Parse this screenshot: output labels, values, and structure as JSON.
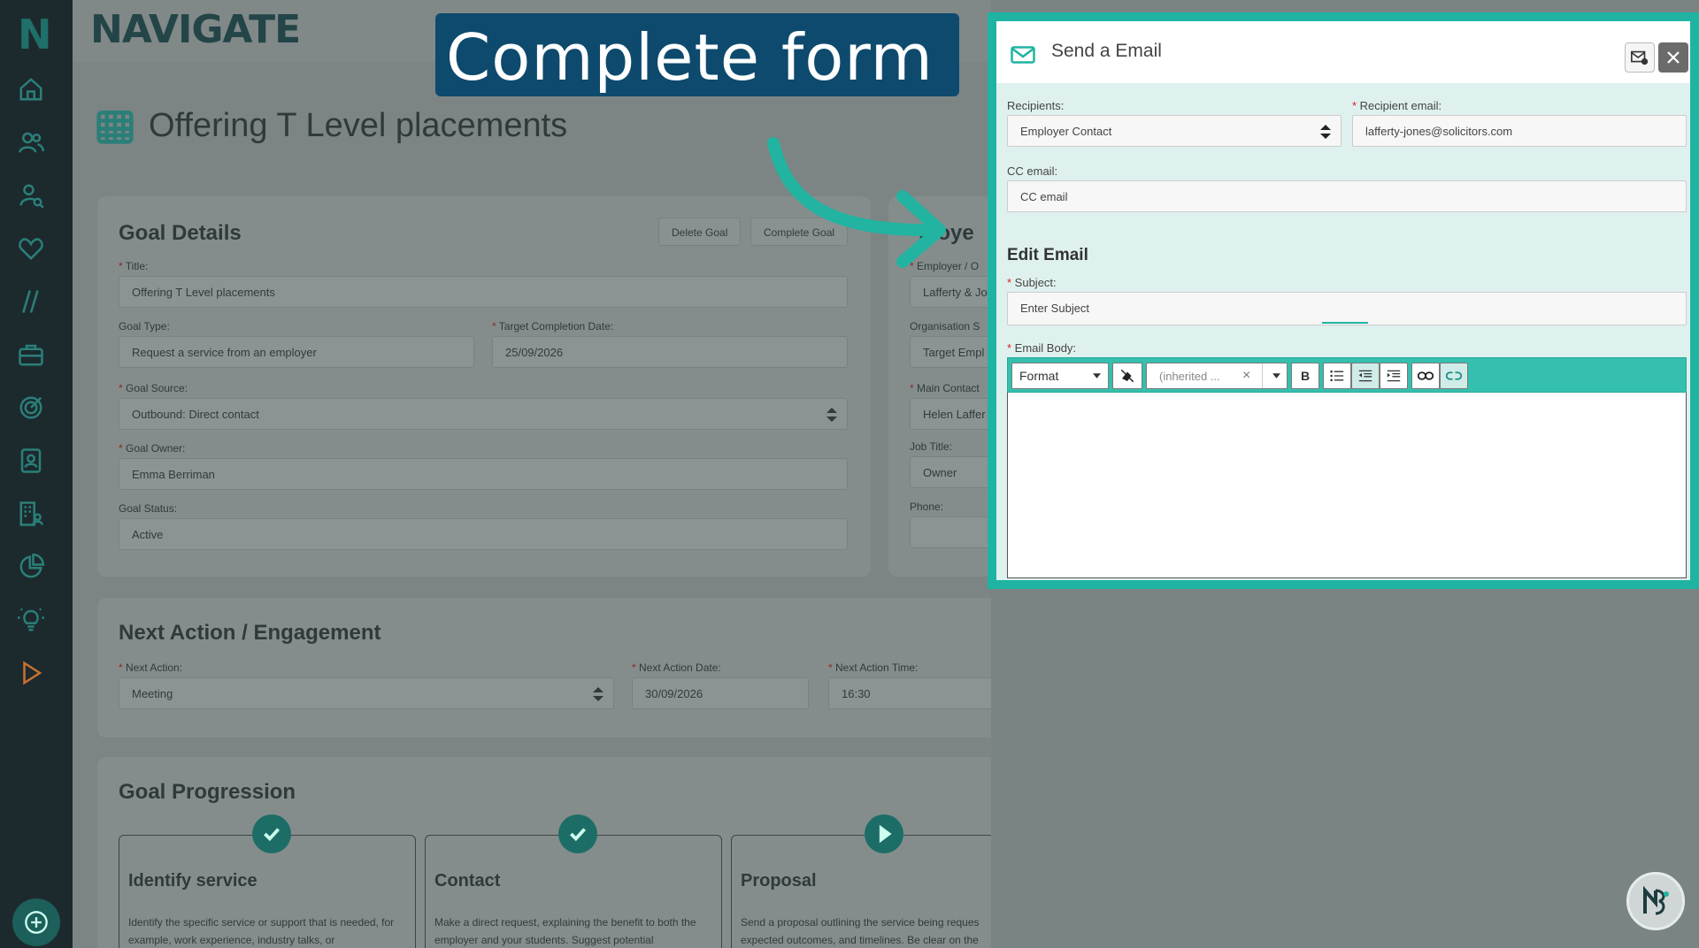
{
  "brand": {
    "logo_letter": "N",
    "wordmark": "NAVIGATE"
  },
  "page": {
    "title": "Offering T Level placements"
  },
  "goal_details": {
    "heading": "Goal Details",
    "delete_label": "Delete Goal",
    "complete_label": "Complete Goal",
    "title_label": "Title:",
    "title_value": "Offering T Level placements",
    "goal_type_label": "Goal Type:",
    "goal_type_value": "Request a service from an employer",
    "target_date_label": "Target Completion Date:",
    "target_date_value": "25/09/2026",
    "goal_source_label": "Goal Source:",
    "goal_source_value": "Outbound: Direct contact",
    "goal_owner_label": "Goal Owner:",
    "goal_owner_value": "Emma Berriman",
    "goal_status_label": "Goal Status:",
    "goal_status_value": "Active"
  },
  "employer_card": {
    "heading": "ploye",
    "employer_label": "Employer / O",
    "employer_value": "Lafferty & Jo",
    "org_label": "Organisation S",
    "org_value": "Target Empl",
    "main_contact_label": "Main Contact",
    "main_contact_value": "Helen Laffer",
    "job_title_label": "Job Title:",
    "job_title_value": "Owner",
    "phone_label": "Phone:",
    "phone_value": ""
  },
  "next_action": {
    "heading": "Next Action / Engagement",
    "action_label": "Next Action:",
    "action_value": "Meeting",
    "date_label": "Next Action Date:",
    "date_value": "30/09/2026",
    "time_label": "Next Action Time:",
    "time_value": "16:30"
  },
  "progression": {
    "heading": "Goal Progression",
    "steps": [
      {
        "title": "Identify service",
        "text": "Identify the specific service or support that is needed, for example, work experience, industry talks, or"
      },
      {
        "title": "Contact",
        "text": "Make a direct request, explaining the benefit to both the employer and your students. Suggest potential"
      },
      {
        "title": "Proposal",
        "text": "Send a proposal outlining the service being reques expected outcomes, and timelines. Be clear on the"
      }
    ]
  },
  "callout": {
    "text": "Complete form"
  },
  "modal": {
    "title": "Send a Email",
    "recipients_label": "Recipients:",
    "recipients_value": "Employer Contact",
    "recipient_email_label": "Recipient email:",
    "recipient_email_value": "lafferty-jones@solicitors.com",
    "cc_label": "CC email:",
    "cc_placeholder": "CC email",
    "edit_heading": "Edit Email",
    "subject_label": "Subject:",
    "subject_placeholder": "Enter Subject",
    "body_label": "Email Body:",
    "toolbar": {
      "format_label": "Format",
      "font_label": "(inherited ...",
      "clear_glyph": "×",
      "bold_label": "B"
    }
  },
  "colors": {
    "accent": "#1fb4a2",
    "toolbar": "#35bfae",
    "callout_bg": "#0e4a6e",
    "sidebar": "#1c2a2e"
  }
}
